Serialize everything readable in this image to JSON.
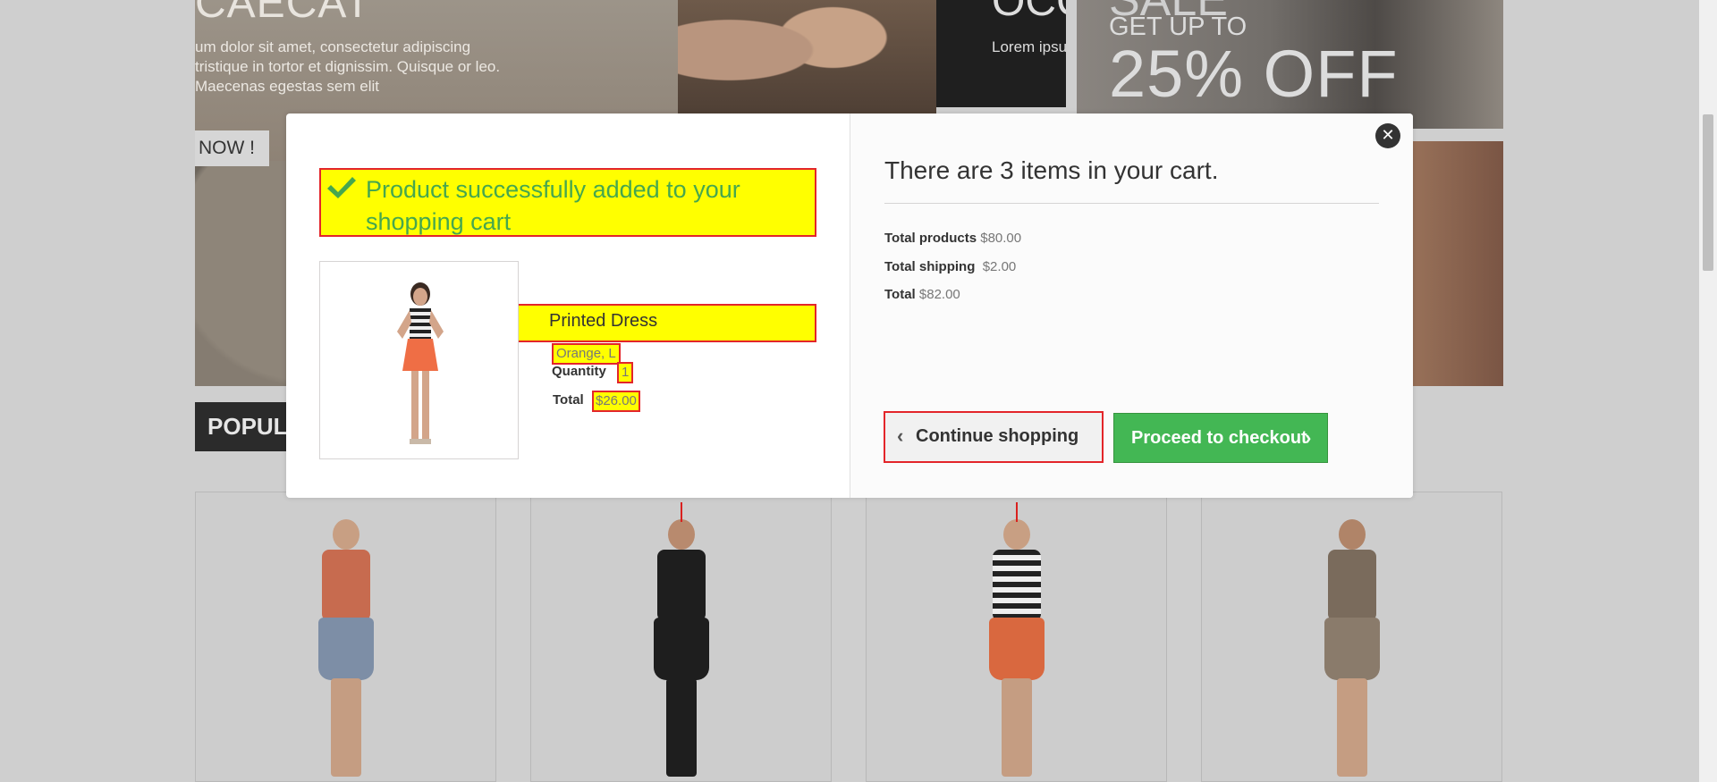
{
  "background": {
    "banner_left": {
      "headline": "CAECAT",
      "copy": "um dolor sit amet, consectetur adipiscing tristique in tortor et dignissim. Quisque or leo. Maecenas egestas sem elit",
      "shop_now": "NOW !"
    },
    "banner_dark": {
      "headline": "OCC",
      "copy": "Lorem ipsu elit. Proin non tempo"
    },
    "banner_sale": {
      "line1": "SALE",
      "line2": "GET UP TO",
      "line3": "25% OFF"
    },
    "popular_tab": "POPULA"
  },
  "modal": {
    "close_icon": "close-icon",
    "success_message": "Product successfully added to your shopping cart",
    "product": {
      "name": "Printed Dress",
      "attributes": "Orange, L",
      "quantity_label": "Quantity",
      "quantity": "1",
      "total_label": "Total",
      "total": "$26.00"
    },
    "cart": {
      "heading": "There are 3 items in your cart.",
      "total_products_label": "Total products",
      "total_products": "$80.00",
      "total_shipping_label": "Total shipping",
      "total_shipping": "$2.00",
      "total_label": "Total",
      "total": "$82.00"
    },
    "buttons": {
      "continue_shopping": "Continue shopping",
      "proceed_to_checkout": "Proceed to checkout"
    }
  },
  "colors": {
    "success_green": "#46a74e",
    "checkout_green": "#43b754",
    "highlight_yellow": "#ffff00",
    "highlight_border": "#e3252a"
  }
}
